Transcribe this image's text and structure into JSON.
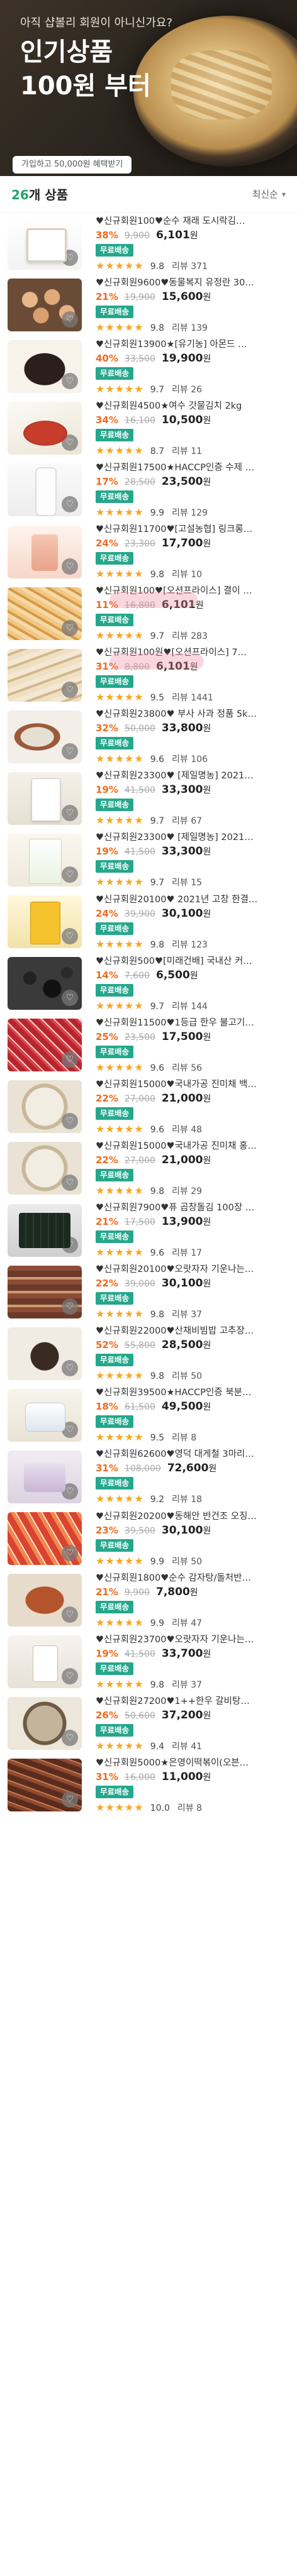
{
  "hero": {
    "subtitle": "아직 샵볼리 회원이 아니신가요?",
    "title": "인기상품\n100원 부터",
    "badge": "가입하고 50,000원 혜택받기"
  },
  "list": {
    "count_num": "26",
    "count_suffix": "개 상품",
    "sort_label": "최신순"
  },
  "colors": {
    "accent": "#25a78c",
    "discount": "#f06a1d",
    "star": "#f5a623"
  },
  "icons": {
    "heart": "heart-icon",
    "sort": "chevron-down-icon",
    "star": "star-icon"
  },
  "products": [
    {
      "title": "♥신규회원100♥순수 재래 도시락김…",
      "discount": "38%",
      "original": "9,900",
      "price": "6,101",
      "won": "원",
      "shipping": "무료배송",
      "score": "9.8",
      "reviews": "리뷰 371"
    },
    {
      "title": "♥신규회원9600♥동물복지 유정란 30…",
      "discount": "21%",
      "original": "19,900",
      "price": "15,600",
      "won": "원",
      "shipping": "무료배송",
      "score": "9.8",
      "reviews": "리뷰 139"
    },
    {
      "title": "♥신규회원13900★[유기농] 아몬드 …",
      "discount": "40%",
      "original": "33,500",
      "price": "19,900",
      "won": "원",
      "shipping": "무료배송",
      "score": "9.7",
      "reviews": "리뷰 26"
    },
    {
      "title": "♥신규회원4500★여수 갓물김치 2kg",
      "discount": "34%",
      "original": "16,100",
      "price": "10,500",
      "won": "원",
      "shipping": "무료배송",
      "score": "8.7",
      "reviews": "리뷰 11"
    },
    {
      "title": "♥신규회원17500★HACCP인증 수제 …",
      "discount": "17%",
      "original": "28,500",
      "price": "23,500",
      "won": "원",
      "shipping": "무료배송",
      "score": "9.9",
      "reviews": "리뷰 129"
    },
    {
      "title": "♥신규회원11700♥[고설농협] 링크롱…",
      "discount": "24%",
      "original": "23,300",
      "price": "17,700",
      "won": "원",
      "shipping": "무료배송",
      "score": "9.8",
      "reviews": "리뷰 10"
    },
    {
      "title": "♥신규회원100♥[오션프라이스] 결이 …",
      "discount": "11%",
      "original": "16,800",
      "price": "6,101",
      "won": "원",
      "shipping": "무료배송",
      "score": "9.7",
      "reviews": "리뷰 283"
    },
    {
      "title": "♥신규회원100원♥[오션프라이스] 7…",
      "discount": "31%",
      "original": "8,800",
      "price": "6,101",
      "won": "원",
      "shipping": "무료배송",
      "score": "9.5",
      "reviews": "리뷰 1441"
    },
    {
      "title": "♥신규회원23800♥ 부사 사과 정품 5k…",
      "discount": "32%",
      "original": "50,000",
      "price": "33,800",
      "won": "원",
      "shipping": "무료배송",
      "score": "9.6",
      "reviews": "리뷰 106"
    },
    {
      "title": "♥신규회원23300♥ [제일명농] 2021…",
      "discount": "19%",
      "original": "41,500",
      "price": "33,300",
      "won": "원",
      "shipping": "무료배송",
      "score": "9.7",
      "reviews": "리뷰 67"
    },
    {
      "title": "♥신규회원23300♥ [제일명농] 2021…",
      "discount": "19%",
      "original": "41,500",
      "price": "33,300",
      "won": "원",
      "shipping": "무료배송",
      "score": "9.7",
      "reviews": "리뷰 15"
    },
    {
      "title": "♥신규회원20100♥ 2021년 고창 한결…",
      "discount": "24%",
      "original": "39,900",
      "price": "30,100",
      "won": "원",
      "shipping": "무료배송",
      "score": "9.8",
      "reviews": "리뷰 123"
    },
    {
      "title": "♥신규회원500♥[미래건배] 국내산 커…",
      "discount": "14%",
      "original": "7,600",
      "price": "6,500",
      "won": "원",
      "shipping": "무료배송",
      "score": "9.7",
      "reviews": "리뷰 144"
    },
    {
      "title": "♥신규회원11500♥1등급 한우 불고기…",
      "discount": "25%",
      "original": "23,500",
      "price": "17,500",
      "won": "원",
      "shipping": "무료배송",
      "score": "9.6",
      "reviews": "리뷰 56"
    },
    {
      "title": "♥신규회원15000♥국내가공 진미채 백…",
      "discount": "22%",
      "original": "27,000",
      "price": "21,000",
      "won": "원",
      "shipping": "무료배송",
      "score": "9.6",
      "reviews": "리뷰 48"
    },
    {
      "title": "♥신규회원15000♥국내가공 진미채 홍…",
      "discount": "22%",
      "original": "27,000",
      "price": "21,000",
      "won": "원",
      "shipping": "무료배송",
      "score": "9.8",
      "reviews": "리뷰 29"
    },
    {
      "title": "♥신규회원7900♥퓨 곱창돌김 100장 …",
      "discount": "21%",
      "original": "17,500",
      "price": "13,900",
      "won": "원",
      "shipping": "무료배송",
      "score": "9.6",
      "reviews": "리뷰 17"
    },
    {
      "title": "♥신규회원20100♥오랏자자 기운나는…",
      "discount": "22%",
      "original": "39,000",
      "price": "30,100",
      "won": "원",
      "shipping": "무료배송",
      "score": "9.8",
      "reviews": "리뷰 37"
    },
    {
      "title": "♥신규회원22000♥산채비빔밥 고추장…",
      "discount": "52%",
      "original": "55,800",
      "price": "28,500",
      "won": "원",
      "shipping": "무료배송",
      "score": "9.8",
      "reviews": "리뷰 50"
    },
    {
      "title": "♥신규회원39500★HACCP인증 북분…",
      "discount": "18%",
      "original": "61,500",
      "price": "49,500",
      "won": "원",
      "shipping": "무료배송",
      "score": "9.5",
      "reviews": "리뷰 8"
    },
    {
      "title": "♥신규회원62600♥영덕 대게철 3마리…",
      "discount": "31%",
      "original": "108,000",
      "price": "72,600",
      "won": "원",
      "shipping": "무료배송",
      "score": "9.2",
      "reviews": "리뷰 18"
    },
    {
      "title": "♥신규회원20200♥동해안 반건조 오징…",
      "discount": "23%",
      "original": "39,500",
      "price": "30,100",
      "won": "원",
      "shipping": "무료배송",
      "score": "9.9",
      "reviews": "리뷰 50"
    },
    {
      "title": "♥신규회원1800♥순수 감자탕/돌처반…",
      "discount": "21%",
      "original": "9,900",
      "price": "7,800",
      "won": "원",
      "shipping": "무료배송",
      "score": "9.9",
      "reviews": "리뷰 47"
    },
    {
      "title": "♥신규회원23700♥오랏자자 기운나는…",
      "discount": "19%",
      "original": "41,500",
      "price": "33,700",
      "won": "원",
      "shipping": "무료배송",
      "score": "9.8",
      "reviews": "리뷰 37"
    },
    {
      "title": "♥신규회원27200♥1++한우 갈비탕…",
      "discount": "26%",
      "original": "50,600",
      "price": "37,200",
      "won": "원",
      "shipping": "무료배송",
      "score": "9.4",
      "reviews": "리뷰 41"
    },
    {
      "title": "♥신규회원5000★은영이떡볶이(오븐…",
      "discount": "31%",
      "original": "16,000",
      "price": "11,000",
      "won": "원",
      "shipping": "무료배송",
      "score": "10.0",
      "reviews": "리뷰 8"
    }
  ]
}
